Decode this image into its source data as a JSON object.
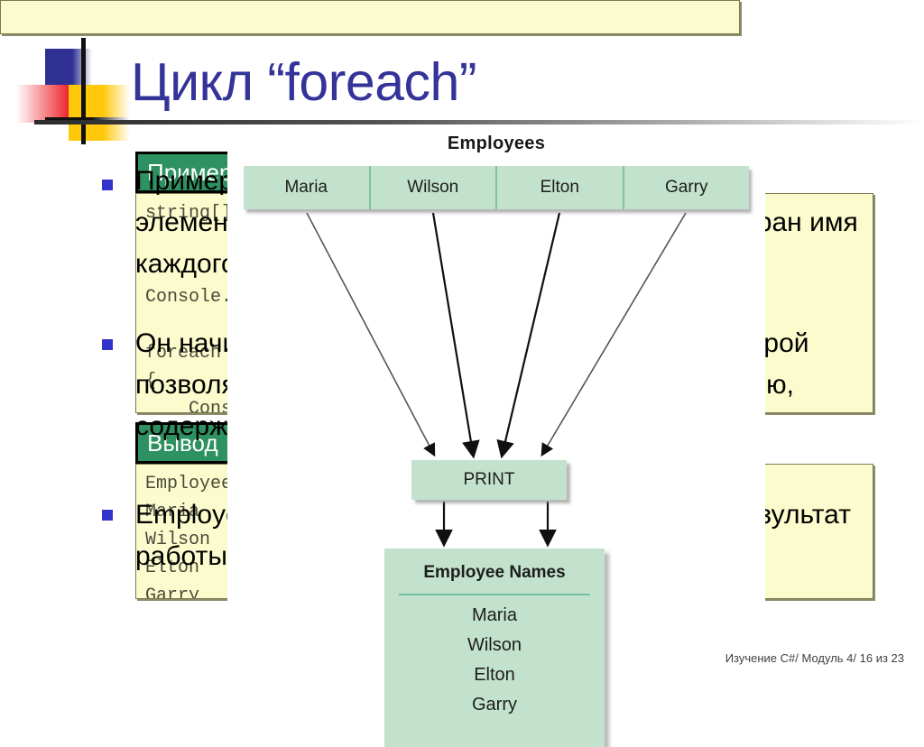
{
  "slide": {
    "title": "Цикл “foreach”",
    "footer": "Изучение C#/ Модуль 4/ 16 из 23"
  },
  "colors": {
    "title_blue": "#333399",
    "bullet_blue": "#3333cc",
    "panel_header_green": "#2e9161",
    "code_background_yellow": "#fbfbcd",
    "diagram_green": "#c3e2cd",
    "diagram_divider": "#7fc3a2",
    "logo_blue": "#2e3192",
    "logo_red": "#ed1c24",
    "logo_yellow": "#ffc80a"
  },
  "body": {
    "paragraphs": [
      "Пример цикла foreach, который проходит по всем элементам в списке сотрудников и выводит на экран имя каждого значения.",
      "Он начинается с ключевого слова foreach, за которой позволяет последовательно перебирать коллекцию, содержащую набор однотипных элементов.",
      "Employee Names: Maria, Wilson, Elton, Garry — результат работы цикла."
    ]
  },
  "panels": [
    {
      "name": "example",
      "header": "Пример",
      "code": "string[] employees = { “Maria”, “Wilson”,\n                       “Elton”, “Garry” };\n\nConsole.WriteLine(“Employee Names”);\n\nforeach (string name in employees)\n{\n    Console.WriteLine(name);\n}"
    },
    {
      "name": "output",
      "header": "Вывод",
      "code": "Employee Names\nMaria\nWilson\nElton\nGarry"
    }
  ],
  "diagram": {
    "title": "Employees",
    "array_cells": [
      "Maria",
      "Wilson",
      "Elton",
      "Garry"
    ],
    "process_box": "PRINT",
    "result_box": {
      "title": "Employee Names",
      "items": [
        "Maria",
        "Wilson",
        "Elton",
        "Garry"
      ]
    }
  }
}
